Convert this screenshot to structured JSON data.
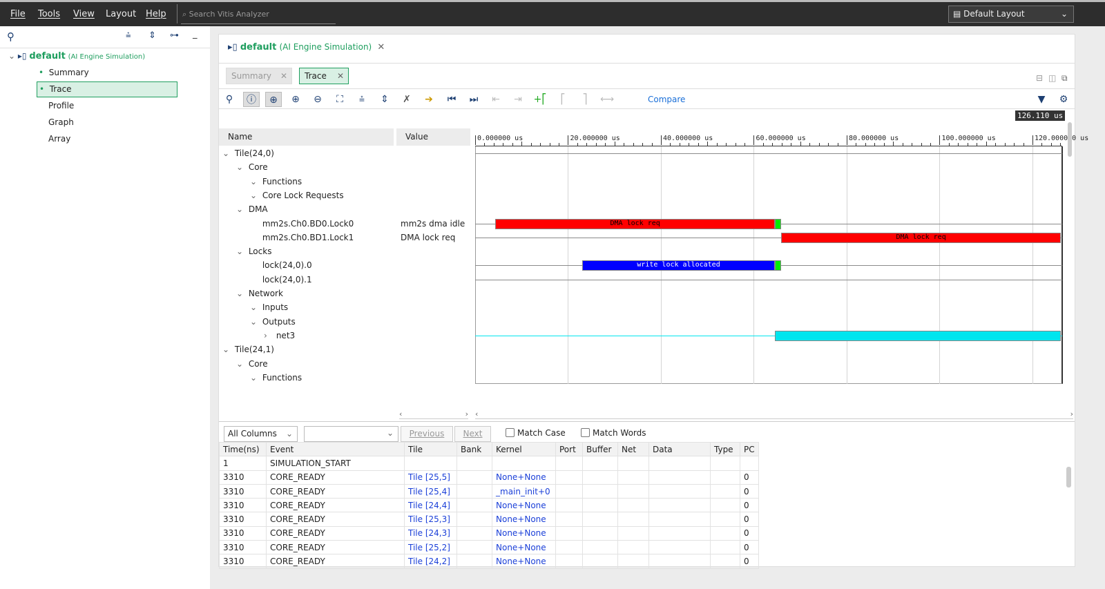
{
  "menubar": {
    "items": [
      "File",
      "Tools",
      "View",
      "Layout",
      "Help"
    ],
    "search_placeholder": "Search Vitis Analyzer",
    "layout": "Default Layout"
  },
  "left": {
    "root": "default",
    "root_sub": "(AI Engine Simulation)",
    "items": [
      "Summary",
      "Trace",
      "Profile",
      "Graph",
      "Array"
    ],
    "selected": "Trace"
  },
  "main": {
    "title": "default",
    "title_sub": "(AI Engine Simulation)",
    "tabs": [
      "Summary",
      "Trace"
    ],
    "active_tab": "Trace",
    "compare": "Compare",
    "cursor_time": "126.110 us"
  },
  "waveform": {
    "name_header": "Name",
    "value_header": "Value",
    "rows": [
      {
        "label": "Tile(24,0)",
        "level": 0,
        "expander": "v",
        "value": ""
      },
      {
        "label": "Core",
        "level": 1,
        "expander": "v",
        "value": ""
      },
      {
        "label": "Functions",
        "level": 2,
        "expander": "v",
        "value": ""
      },
      {
        "label": "Core Lock Requests",
        "level": 2,
        "expander": "v",
        "value": ""
      },
      {
        "label": "DMA",
        "level": 1,
        "expander": "v",
        "value": ""
      },
      {
        "label": "mm2s.Ch0.BD0.Lock0",
        "level": 2,
        "expander": "",
        "value": "mm2s dma idle"
      },
      {
        "label": "mm2s.Ch0.BD1.Lock1",
        "level": 2,
        "expander": "",
        "value": "DMA lock req"
      },
      {
        "label": "Locks",
        "level": 1,
        "expander": "v",
        "value": ""
      },
      {
        "label": "lock(24,0).0",
        "level": 2,
        "expander": "",
        "value": ""
      },
      {
        "label": "lock(24,0).1",
        "level": 2,
        "expander": "",
        "value": ""
      },
      {
        "label": "Network",
        "level": 1,
        "expander": "v",
        "value": ""
      },
      {
        "label": "Inputs",
        "level": 2,
        "expander": "v",
        "value": ""
      },
      {
        "label": "Outputs",
        "level": 2,
        "expander": "v",
        "value": ""
      },
      {
        "label": "net3",
        "level": 3,
        "expander": ">",
        "value": ""
      },
      {
        "label": "Tile(24,1)",
        "level": 0,
        "expander": "v",
        "value": ""
      },
      {
        "label": "Core",
        "level": 1,
        "expander": "v",
        "value": ""
      },
      {
        "label": "Functions",
        "level": 2,
        "expander": "v",
        "value": ""
      }
    ],
    "time_unit": "us",
    "time_range": [
      0,
      126.11
    ],
    "ticks": [
      "0.000000 us",
      "20.000000 us",
      "40.000000 us",
      "60.000000 us",
      "80.000000 us",
      "100.000000 us",
      "120.000000 us"
    ],
    "tick_values": [
      0,
      20,
      40,
      60,
      80,
      100,
      120
    ],
    "signals": [
      {
        "row": 5,
        "segments": [
          {
            "start": 4.3,
            "end": 64.6,
            "label": "DMA lock req",
            "color": "#ff0000"
          },
          {
            "start": 64.6,
            "end": 65.9,
            "label": "",
            "color": "#00ee00"
          }
        ]
      },
      {
        "row": 6,
        "segments": [
          {
            "start": 65.9,
            "end": 126.11,
            "label": "DMA lock req",
            "color": "#ff0000"
          }
        ]
      },
      {
        "row": 8,
        "segments": [
          {
            "start": 23.0,
            "end": 64.6,
            "label": "write lock allocated",
            "color": "#0000ff"
          },
          {
            "start": 64.6,
            "end": 65.9,
            "label": "",
            "color": "#00ee00"
          }
        ]
      },
      {
        "row": 9,
        "segments": []
      },
      {
        "row": 13,
        "segments": [
          {
            "start": 64.6,
            "end": 126.11,
            "label": "",
            "color": "#00e5ee"
          }
        ]
      }
    ]
  },
  "search": {
    "column": "All Columns",
    "previous": "Previous",
    "next": "Next",
    "match_case": "Match Case",
    "match_words": "Match Words"
  },
  "events": {
    "columns": [
      "Time(ns)",
      "Event",
      "Tile",
      "Bank",
      "Kernel",
      "Port",
      "Buffer",
      "Net",
      "Data",
      "Type",
      "PC"
    ],
    "rows": [
      [
        "1",
        "SIMULATION_START",
        "",
        "",
        "",
        "",
        "",
        "",
        "",
        "",
        ""
      ],
      [
        "3310",
        "CORE_READY",
        "Tile [25,5]",
        "",
        "None+None",
        "",
        "",
        "",
        "",
        "",
        "0"
      ],
      [
        "3310",
        "CORE_READY",
        "Tile [25,4]",
        "",
        "_main_init+0",
        "",
        "",
        "",
        "",
        "",
        "0"
      ],
      [
        "3310",
        "CORE_READY",
        "Tile [24,4]",
        "",
        "None+None",
        "",
        "",
        "",
        "",
        "",
        "0"
      ],
      [
        "3310",
        "CORE_READY",
        "Tile [25,3]",
        "",
        "None+None",
        "",
        "",
        "",
        "",
        "",
        "0"
      ],
      [
        "3310",
        "CORE_READY",
        "Tile [24,3]",
        "",
        "None+None",
        "",
        "",
        "",
        "",
        "",
        "0"
      ],
      [
        "3310",
        "CORE_READY",
        "Tile [25,2]",
        "",
        "None+None",
        "",
        "",
        "",
        "",
        "",
        "0"
      ],
      [
        "3310",
        "CORE_READY",
        "Tile [24,2]",
        "",
        "None+None",
        "",
        "",
        "",
        "",
        "",
        "0"
      ]
    ]
  },
  "colors": {
    "accent": "#1e9e5e",
    "link": "#1a3fd8",
    "selected_bg": "#d9f0e4"
  }
}
